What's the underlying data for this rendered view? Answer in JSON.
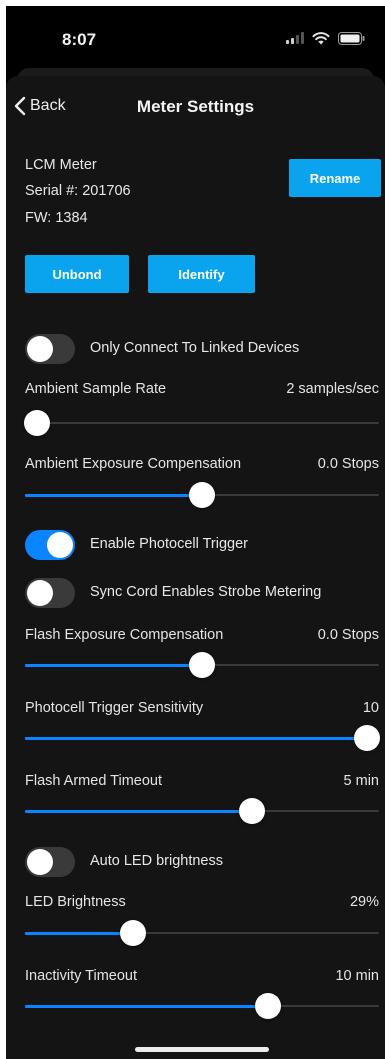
{
  "status_bar": {
    "time": "8:07",
    "signal_icon": "signal-icon",
    "wifi_icon": "wifi-icon",
    "battery_icon": "battery-icon"
  },
  "nav": {
    "back_label": "Back",
    "back_icon": "chevron-left-icon",
    "title": "Meter Settings"
  },
  "device": {
    "name": "LCM Meter",
    "serial": "Serial #: 201706",
    "firmware": "FW: 1384",
    "rename_label": "Rename",
    "unbond_label": "Unbond",
    "identify_label": "Identify"
  },
  "settings": {
    "only_connect": {
      "label": "Only Connect To Linked Devices",
      "on": false
    },
    "ambient_sample_rate": {
      "label": "Ambient Sample Rate",
      "value": "2 samples/sec",
      "level": 0.0
    },
    "ambient_exposure": {
      "label": "Ambient Exposure Compensation",
      "value": "0.0 Stops",
      "level": 0.5
    },
    "photocell_trigger": {
      "label": "Enable Photocell Trigger",
      "on": true
    },
    "sync_cord": {
      "label": "Sync Cord Enables Strobe Metering",
      "on": false
    },
    "flash_exposure": {
      "label": "Flash Exposure Compensation",
      "value": "0.0 Stops",
      "level": 0.5
    },
    "photocell_sensitivity": {
      "label": "Photocell Trigger Sensitivity",
      "value": "10",
      "level": 1.0
    },
    "flash_armed_timeout": {
      "label": "Flash Armed Timeout",
      "value": "5 min",
      "level": 0.65
    },
    "auto_led": {
      "label": "Auto LED brightness",
      "on": false
    },
    "led_brightness": {
      "label": "LED Brightness",
      "value": "29%",
      "level": 0.29
    },
    "inactivity_timeout": {
      "label": "Inactivity Timeout",
      "value": "10 min",
      "level": 0.7
    }
  },
  "colors": {
    "accent": "#0a84ff",
    "button": "#0aa3ee",
    "background": "#141414"
  }
}
